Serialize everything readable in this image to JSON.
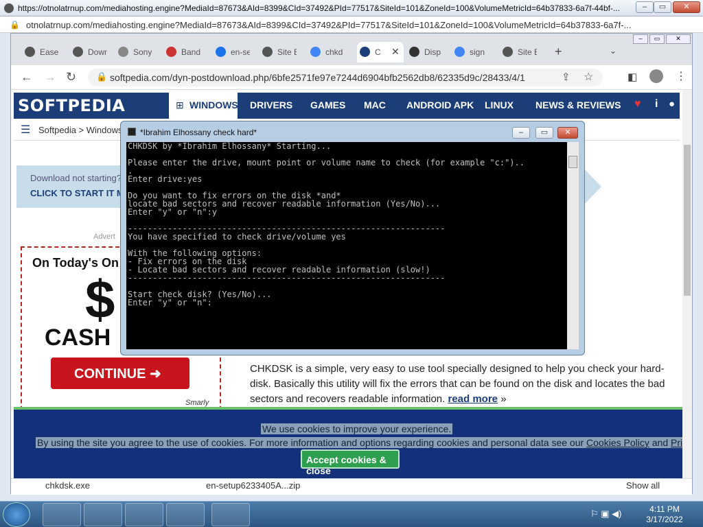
{
  "outer": {
    "title_url": "https://otnolatrnup.com/mediahosting.engine?MediaId=87673&AId=8399&CId=37492&PId=77517&SiteId=101&ZoneId=100&VolumeMetricId=64b37833-6a7f-44bf-...",
    "addr_url": "otnolatrnup.com/mediahosting.engine?MediaId=87673&AId=8399&CId=37492&PId=77517&SiteId=101&ZoneId=100&VolumeMetricId=64b37833-6a7f-..."
  },
  "tabs": [
    {
      "label": "EaseU",
      "color": "#555"
    },
    {
      "label": "Down",
      "color": "#555"
    },
    {
      "label": "Sony",
      "color": "#888"
    },
    {
      "label": "Band",
      "color": "#c33"
    },
    {
      "label": "en-se",
      "color": "#1a73e8"
    },
    {
      "label": "Site B",
      "color": "#555"
    },
    {
      "label": "chkd",
      "color": "#4285f4"
    },
    {
      "label": "C",
      "color": "#1c3e78"
    },
    {
      "label": "Disp",
      "color": "#333"
    },
    {
      "label": "sign",
      "color": "#4285f4"
    },
    {
      "label": "Site B",
      "color": "#555"
    }
  ],
  "omnibox": {
    "url": "softpedia.com/dyn-postdownload.php/6bfe2571fe97e7244d6904bfb2562db8/62335d9c/28433/4/1"
  },
  "softpedia": {
    "logo": "SOFTPEDIA",
    "nav": [
      "WINDOWS",
      "DRIVERS",
      "GAMES",
      "MAC",
      "ANDROID APK",
      "LINUX",
      "NEWS & REVIEWS"
    ],
    "breadcrumb": "Softpedia  >  Windows"
  },
  "download": {
    "not_started": "Download not starting?",
    "click": "CLICK TO START IT M"
  },
  "ad": {
    "label": "Advert",
    "headline": "On Today's On",
    "dollar": "$",
    "cash": "CASH",
    "continue": "CONTINUE ➜",
    "small": "Smarly"
  },
  "description": {
    "text": "CHKDSK is a simple, very easy to use tool specially designed to help you check your hard-disk. Basically this utility will fix the errors that can be found on the disk and locates the bad sectors and recovers readable information.",
    "more": "read more",
    "more_suffix": " »"
  },
  "cookie": {
    "line1": "We use cookies to improve your experience.",
    "line2": "By using the site you agree to the use of cookies. For more information and options regarding cookies and personal data see our ",
    "policy1": "Cookies Policy",
    "and": " and ",
    "policy2": "Privacy Policy",
    "button": "Accept cookies & close"
  },
  "downloads_shelf": {
    "file1": "chkdsk.exe",
    "file2": "en-setup6233405A...zip",
    "show_all": "Show all"
  },
  "console": {
    "title": "*Ibrahim Elhossany check hard*",
    "text": "CHKDSK by *Ibrahim Elhossany* Starting...\n\nPlease enter the drive, mount point or volume name to check (for example \"c:\")..\n.\nEnter drive:yes\n\nDo you want to fix errors on the disk *and*\nlocate bad sectors and recover readable information (Yes/No)...\nEnter \"y\" or \"n\":y\n\n----------------------------------------------------------------\nYou have specified to check drive/volume yes\n\nWith the following options:\n- Fix errors on the disk\n- Locate bad sectors and recover readable information (slow!)\n----------------------------------------------------------------\n\nStart check disk? (Yes/No)...\nEnter \"y\" or \"n\":"
  },
  "taskbar": {
    "time": "4:11 PM",
    "date": "3/17/2022"
  }
}
